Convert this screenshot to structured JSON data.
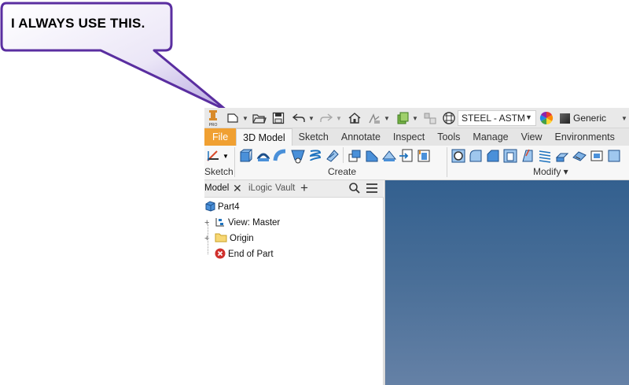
{
  "callout": {
    "text": "I ALWAYS USE THIS."
  },
  "qat": {
    "material": "STEEL - ASTM",
    "appearance": "Generic",
    "logo_text": "PRO"
  },
  "tabs": [
    {
      "label": "File"
    },
    {
      "label": "3D Model"
    },
    {
      "label": "Sketch"
    },
    {
      "label": "Annotate"
    },
    {
      "label": "Inspect"
    },
    {
      "label": "Tools"
    },
    {
      "label": "Manage"
    },
    {
      "label": "View"
    },
    {
      "label": "Environments"
    }
  ],
  "ribbon": {
    "panels": {
      "sketch": "Sketch",
      "create": "Create",
      "modify": "Modify ▾"
    }
  },
  "browser": {
    "tabs": {
      "model": "Model",
      "ilogic": "iLogic",
      "vault": "Vault"
    },
    "tree": [
      {
        "label": "Part4"
      },
      {
        "label": "View: Master"
      },
      {
        "label": "Origin"
      },
      {
        "label": "End of Part"
      }
    ]
  },
  "colors": {
    "file_tab": "#f0a032",
    "viewport_top": "#33608f",
    "viewport_bottom": "#6581a6",
    "callout_fill": "#ebe6f7",
    "callout_border": "#5a2ea0",
    "end_of_part": "#d0312d"
  }
}
